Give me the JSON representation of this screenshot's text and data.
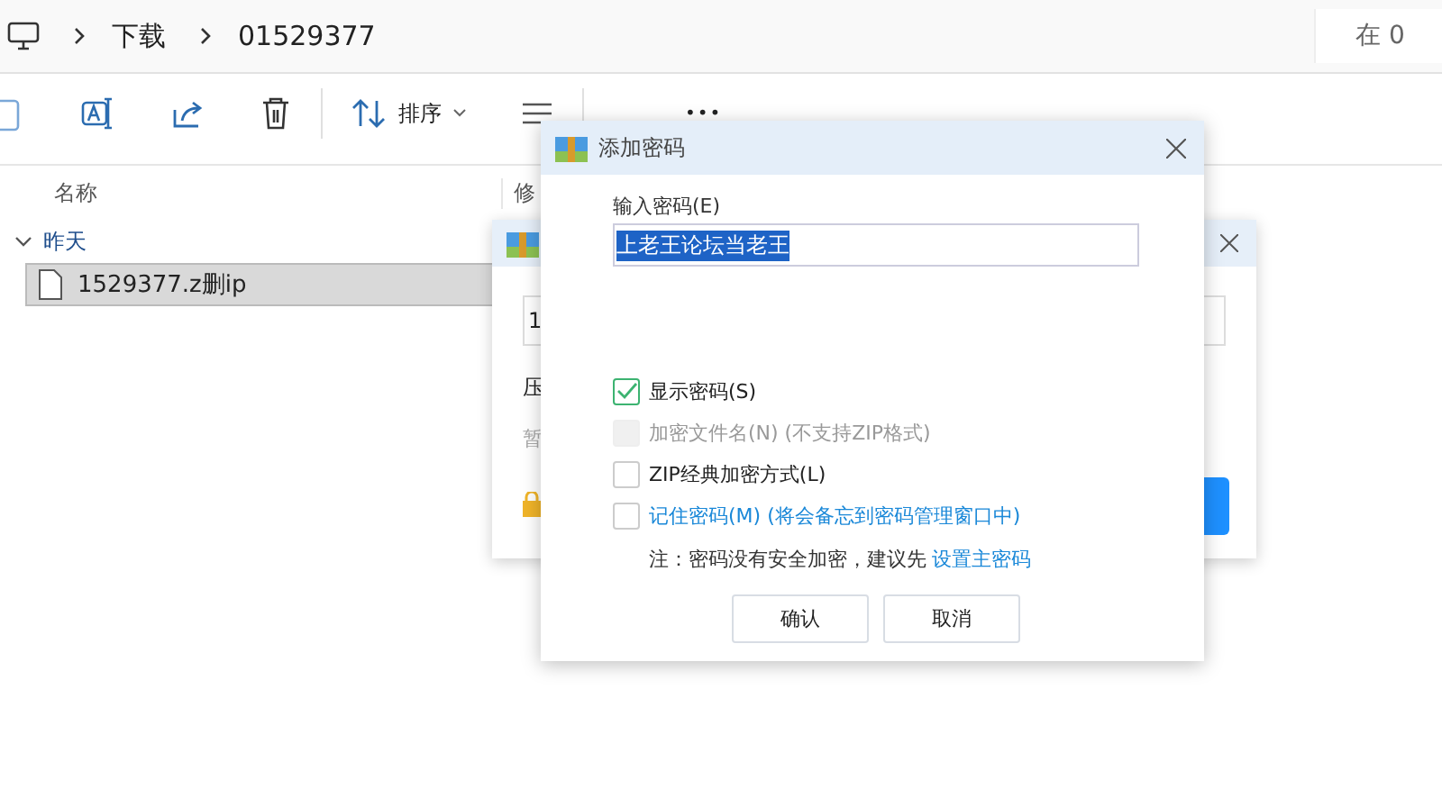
{
  "explorer": {
    "breadcrumb": [
      "下载",
      "01529377"
    ],
    "search_placeholder": "在 0",
    "sort": "排序",
    "more": "•••",
    "columns": [
      "名称",
      "修"
    ],
    "group": {
      "label": "昨天",
      "expanded": true
    },
    "files": [
      {
        "name": "1529377.z删ip",
        "selected": true
      }
    ]
  },
  "back_dialog": {
    "field_value": "1",
    "label_1": "压",
    "label_2": "暂"
  },
  "dialog": {
    "title": "添加密码",
    "field_label": "输入密码(E)",
    "password": "上老王论坛当老王",
    "options": [
      {
        "kind": "plain",
        "label": "显示密码(S)",
        "checked": true,
        "disabled": false
      },
      {
        "kind": "plain",
        "label": "加密文件名(N) (不支持ZIP格式)",
        "checked": false,
        "disabled": true
      },
      {
        "kind": "plain",
        "label": "ZIP经典加密方式(L)",
        "checked": false,
        "disabled": false
      },
      {
        "kind": "link",
        "label": "记住密码(M) (将会备忘到密码管理窗口中)",
        "checked": false,
        "disabled": false
      }
    ],
    "note": "注：密码没有安全加密，建议先",
    "note_link": "设置主密码",
    "buttons": [
      "确认",
      "取消"
    ]
  }
}
